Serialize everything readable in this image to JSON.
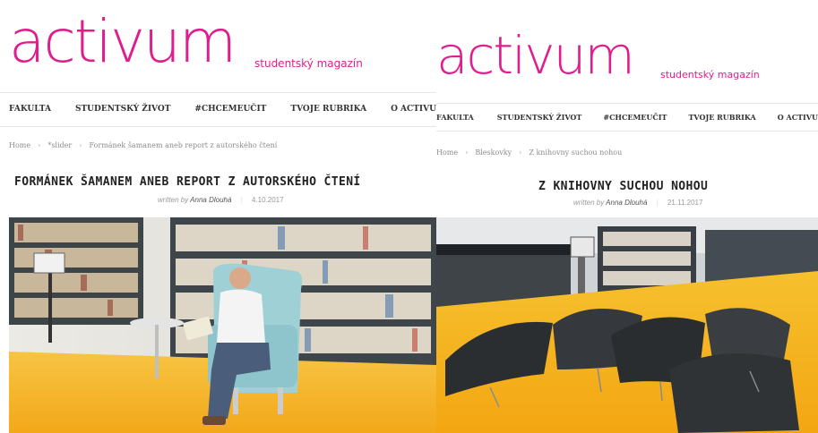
{
  "left": {
    "logo": "activum",
    "tagline": "studentský magazín",
    "nav": [
      "FAKULTA",
      "STUDENTSKÝ ŽIVOT",
      "#CHCEMEUČIT",
      "TVOJE RUBRIKA",
      "O ACTIVU"
    ],
    "breadcrumb": [
      "Home",
      "*slider",
      "Formánek šamanem aneb report z autorského čtení"
    ],
    "title": "FORMÁNEK ŠAMANEM ANEB REPORT Z AUTORSKÉHO ČTENÍ",
    "written_by": "written by",
    "author": "Anna Dlouhá",
    "date": "4.10.2017"
  },
  "right": {
    "logo": "activum",
    "tagline": "studentský magazín",
    "nav": [
      "FAKULTA",
      "STUDENTSKÝ ŽIVOT",
      "#CHCEMEUČIT",
      "TVOJE RUBRIKA",
      "O ACTIVU"
    ],
    "breadcrumb": [
      "Home",
      "Bleskovky",
      "Z knihovny suchou nohou"
    ],
    "title": "Z KNIHOVNY SUCHOU NOHOU",
    "written_by": "written by",
    "author": "Anna Dlouhá",
    "date": "21.11.2017"
  },
  "colors": {
    "brand": "#e01d8c",
    "floor": "#f5b31c",
    "chair": "#9fd0d6"
  },
  "separator": "›"
}
